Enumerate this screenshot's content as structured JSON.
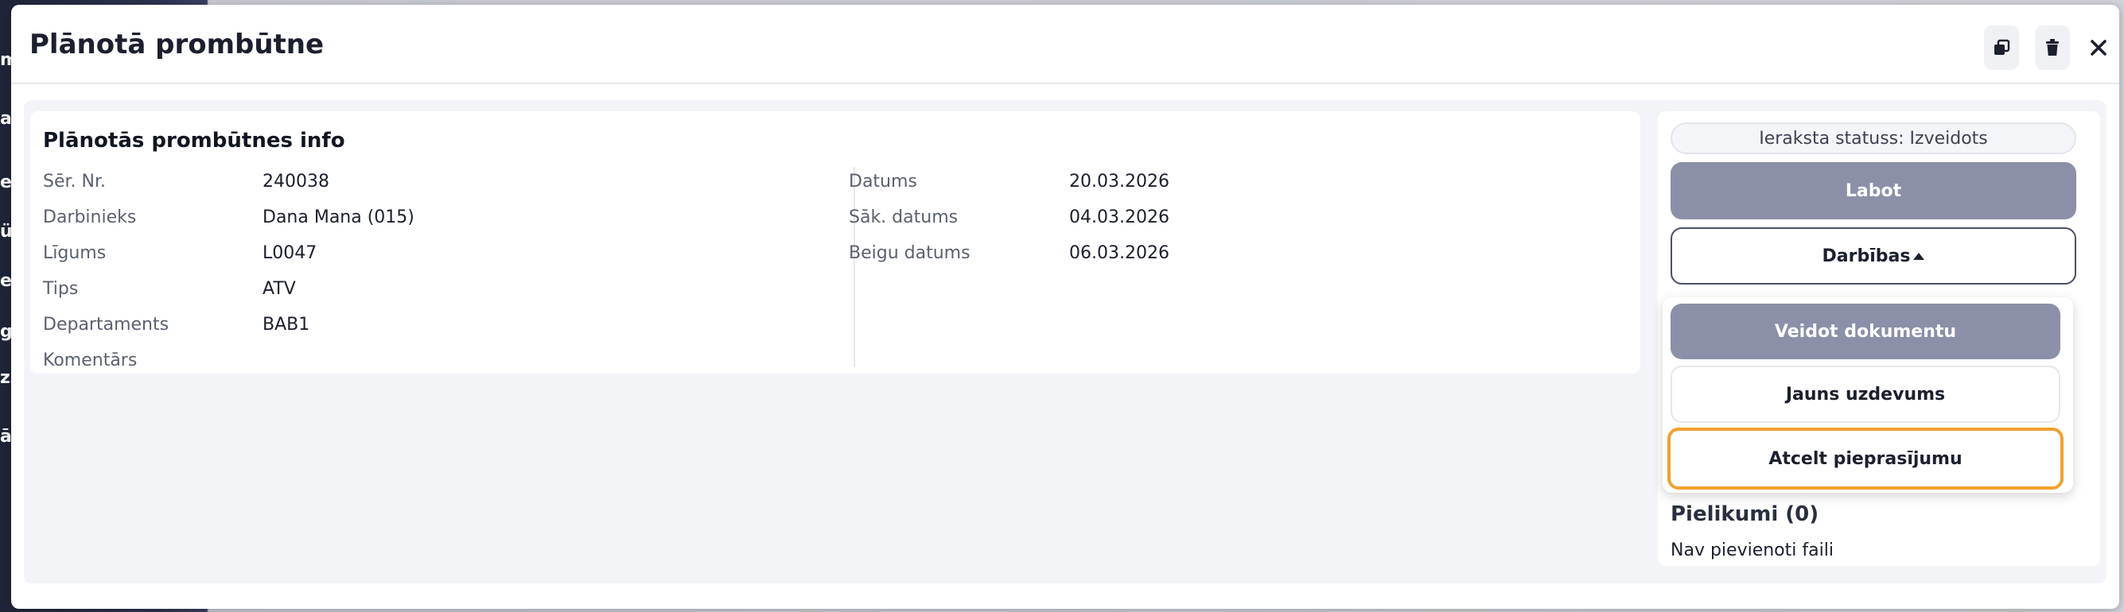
{
  "background": {
    "slivers": [
      "m",
      "ar",
      "es",
      "üt",
      "er",
      "gr",
      "zz",
      "āt"
    ]
  },
  "modal": {
    "title": "Plānotā prombūtne",
    "actions": {
      "copy_icon": "copy-icon",
      "delete_icon": "trash-icon",
      "close_icon": "close-icon"
    }
  },
  "info": {
    "section_title": "Plānotās prombūtnes info",
    "left_fields": [
      {
        "label": "Sēr. Nr.",
        "value": "240038"
      },
      {
        "label": "Darbinieks",
        "value": "Dana Mana  (015)"
      },
      {
        "label": "Līgums",
        "value": "L0047"
      },
      {
        "label": "Tips",
        "value": "ATV"
      },
      {
        "label": "Departaments",
        "value": "BAB1"
      },
      {
        "label": "Komentārs",
        "value": ""
      }
    ],
    "right_fields": [
      {
        "label": "Datums",
        "value": "20.03.2026"
      },
      {
        "label": "Sāk. datums",
        "value": "04.03.2026"
      },
      {
        "label": "Beigu datums",
        "value": "06.03.2026"
      }
    ]
  },
  "side": {
    "status": "Ieraksta statuss: Izveidots",
    "edit_label": "Labot",
    "actions_label": "Darbības",
    "menu": [
      {
        "label": "Veidot dokumentu"
      },
      {
        "label": "Jauns uzdevums"
      },
      {
        "label": "Atcelt pieprasījumu"
      }
    ],
    "attachments_title": "Pielikumi (0)",
    "attachments_empty": "Nav pievienoti faili"
  },
  "colors": {
    "primary_gray": "#8b90a8",
    "focus_ring": "#f0a030",
    "text_dark": "#1b1f2e"
  }
}
